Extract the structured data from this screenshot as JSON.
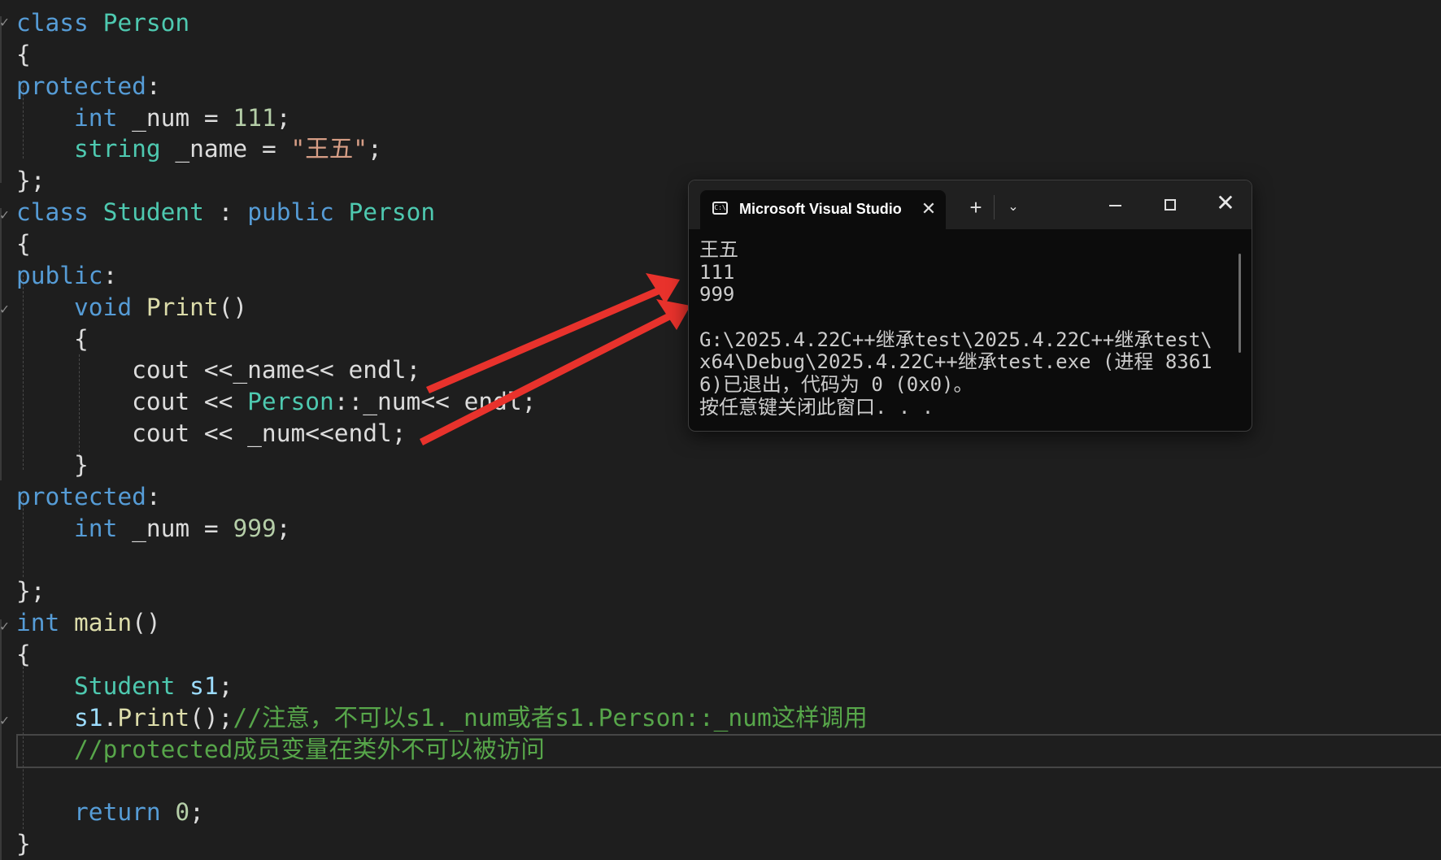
{
  "editor": {
    "lines": [
      [
        [
          "class ",
          "kw"
        ],
        [
          "Person",
          "type"
        ]
      ],
      [
        [
          "{",
          "plain"
        ]
      ],
      [
        [
          "protected",
          "kw"
        ],
        [
          ":",
          "plain"
        ]
      ],
      [
        [
          "    ",
          "plain"
        ],
        [
          "int",
          "kw"
        ],
        [
          " _num = ",
          "plain"
        ],
        [
          "111",
          "num"
        ],
        [
          ";",
          "plain"
        ]
      ],
      [
        [
          "    ",
          "plain"
        ],
        [
          "string",
          "type"
        ],
        [
          " _name = ",
          "plain"
        ],
        [
          "\"王五\"",
          "str"
        ],
        [
          ";",
          "plain"
        ]
      ],
      [
        [
          "};",
          "plain"
        ]
      ],
      [
        [
          "class ",
          "kw"
        ],
        [
          "Student",
          "type"
        ],
        [
          " : ",
          "plain"
        ],
        [
          "public ",
          "kw"
        ],
        [
          "Person",
          "type"
        ]
      ],
      [
        [
          "{",
          "plain"
        ]
      ],
      [
        [
          "public",
          "kw"
        ],
        [
          ":",
          "plain"
        ]
      ],
      [
        [
          "    ",
          "plain"
        ],
        [
          "void ",
          "kw"
        ],
        [
          "Print",
          "fn"
        ],
        [
          "()",
          "plain"
        ]
      ],
      [
        [
          "    {",
          "plain"
        ]
      ],
      [
        [
          "        cout <<_name<< endl;",
          "plain"
        ]
      ],
      [
        [
          "        cout << ",
          "plain"
        ],
        [
          "Person",
          "type"
        ],
        [
          "::_num<< endl;",
          "plain"
        ]
      ],
      [
        [
          "        cout << _num<<endl;",
          "plain"
        ]
      ],
      [
        [
          "    }",
          "plain"
        ]
      ],
      [
        [
          "protected",
          "kw"
        ],
        [
          ":",
          "plain"
        ]
      ],
      [
        [
          "    ",
          "plain"
        ],
        [
          "int",
          "kw"
        ],
        [
          " _num = ",
          "plain"
        ],
        [
          "999",
          "num"
        ],
        [
          ";",
          "plain"
        ]
      ],
      [
        [
          "",
          "plain"
        ]
      ],
      [
        [
          "};",
          "plain"
        ]
      ],
      [
        [
          "int ",
          "kw"
        ],
        [
          "main",
          "fn"
        ],
        [
          "()",
          "plain"
        ]
      ],
      [
        [
          "{",
          "plain"
        ]
      ],
      [
        [
          "    ",
          "plain"
        ],
        [
          "Student ",
          "type"
        ],
        [
          "s1",
          "var"
        ],
        [
          ";",
          "plain"
        ]
      ],
      [
        [
          "    ",
          "plain"
        ],
        [
          "s1",
          "var"
        ],
        [
          ".",
          "plain"
        ],
        [
          "Print",
          "fn"
        ],
        [
          "();",
          "plain"
        ],
        [
          "//注意，不可以s1._num或者s1.Person::_num这样调用",
          "cmt"
        ]
      ],
      [
        [
          "    ",
          "plain"
        ],
        [
          "//protected成员变量在类外不可以被访问",
          "cmt"
        ]
      ],
      [
        [
          "",
          "plain"
        ]
      ],
      [
        [
          "    ",
          "plain"
        ],
        [
          "return ",
          "kw"
        ],
        [
          "0",
          "num"
        ],
        [
          ";",
          "plain"
        ]
      ],
      [
        [
          "}",
          "plain"
        ]
      ]
    ]
  },
  "console": {
    "tab_title": "Microsoft Visual Studio",
    "icon": "terminal-icon",
    "buttons": {
      "close_tab": "✕",
      "new_tab": "+",
      "dropdown": "⌄",
      "close_window": "✕"
    },
    "output": [
      "王五",
      "111",
      "999",
      "",
      "G:\\2025.4.22C++继承test\\2025.4.22C++继承test\\",
      "x64\\Debug\\2025.4.22C++继承test.exe (进程 8361",
      "6)已退出，代码为 0 (0x0)。",
      "按任意键关闭此窗口. . ."
    ]
  },
  "colors": {
    "background": "#1e1e1e",
    "keyword": "#569cd6",
    "type": "#4ec9b0",
    "function": "#dcdcaa",
    "number": "#b5cea8",
    "string": "#d69d85",
    "comment": "#57a64a",
    "arrow": "#e8322c"
  }
}
